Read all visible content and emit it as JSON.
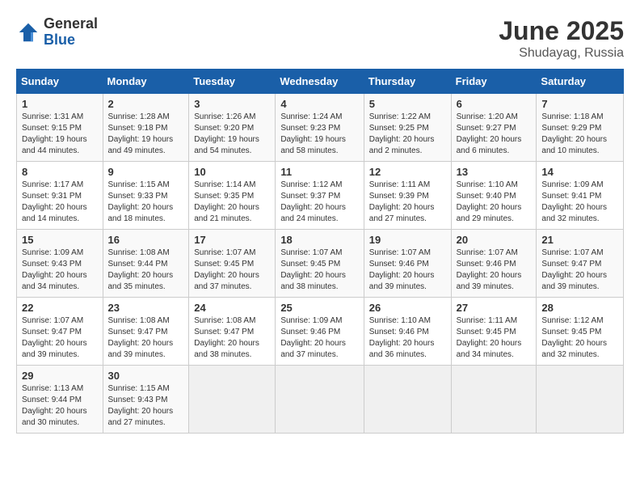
{
  "header": {
    "logo_general": "General",
    "logo_blue": "Blue",
    "month": "June 2025",
    "location": "Shudayag, Russia"
  },
  "days_of_week": [
    "Sunday",
    "Monday",
    "Tuesday",
    "Wednesday",
    "Thursday",
    "Friday",
    "Saturday"
  ],
  "weeks": [
    [
      {
        "day": "1",
        "info": "Sunrise: 1:31 AM\nSunset: 9:15 PM\nDaylight: 19 hours\nand 44 minutes."
      },
      {
        "day": "2",
        "info": "Sunrise: 1:28 AM\nSunset: 9:18 PM\nDaylight: 19 hours\nand 49 minutes."
      },
      {
        "day": "3",
        "info": "Sunrise: 1:26 AM\nSunset: 9:20 PM\nDaylight: 19 hours\nand 54 minutes."
      },
      {
        "day": "4",
        "info": "Sunrise: 1:24 AM\nSunset: 9:23 PM\nDaylight: 19 hours\nand 58 minutes."
      },
      {
        "day": "5",
        "info": "Sunrise: 1:22 AM\nSunset: 9:25 PM\nDaylight: 20 hours\nand 2 minutes."
      },
      {
        "day": "6",
        "info": "Sunrise: 1:20 AM\nSunset: 9:27 PM\nDaylight: 20 hours\nand 6 minutes."
      },
      {
        "day": "7",
        "info": "Sunrise: 1:18 AM\nSunset: 9:29 PM\nDaylight: 20 hours\nand 10 minutes."
      }
    ],
    [
      {
        "day": "8",
        "info": "Sunrise: 1:17 AM\nSunset: 9:31 PM\nDaylight: 20 hours\nand 14 minutes."
      },
      {
        "day": "9",
        "info": "Sunrise: 1:15 AM\nSunset: 9:33 PM\nDaylight: 20 hours\nand 18 minutes."
      },
      {
        "day": "10",
        "info": "Sunrise: 1:14 AM\nSunset: 9:35 PM\nDaylight: 20 hours\nand 21 minutes."
      },
      {
        "day": "11",
        "info": "Sunrise: 1:12 AM\nSunset: 9:37 PM\nDaylight: 20 hours\nand 24 minutes."
      },
      {
        "day": "12",
        "info": "Sunrise: 1:11 AM\nSunset: 9:39 PM\nDaylight: 20 hours\nand 27 minutes."
      },
      {
        "day": "13",
        "info": "Sunrise: 1:10 AM\nSunset: 9:40 PM\nDaylight: 20 hours\nand 29 minutes."
      },
      {
        "day": "14",
        "info": "Sunrise: 1:09 AM\nSunset: 9:41 PM\nDaylight: 20 hours\nand 32 minutes."
      }
    ],
    [
      {
        "day": "15",
        "info": "Sunrise: 1:09 AM\nSunset: 9:43 PM\nDaylight: 20 hours\nand 34 minutes."
      },
      {
        "day": "16",
        "info": "Sunrise: 1:08 AM\nSunset: 9:44 PM\nDaylight: 20 hours\nand 35 minutes."
      },
      {
        "day": "17",
        "info": "Sunrise: 1:07 AM\nSunset: 9:45 PM\nDaylight: 20 hours\nand 37 minutes."
      },
      {
        "day": "18",
        "info": "Sunrise: 1:07 AM\nSunset: 9:45 PM\nDaylight: 20 hours\nand 38 minutes."
      },
      {
        "day": "19",
        "info": "Sunrise: 1:07 AM\nSunset: 9:46 PM\nDaylight: 20 hours\nand 39 minutes."
      },
      {
        "day": "20",
        "info": "Sunrise: 1:07 AM\nSunset: 9:46 PM\nDaylight: 20 hours\nand 39 minutes."
      },
      {
        "day": "21",
        "info": "Sunrise: 1:07 AM\nSunset: 9:47 PM\nDaylight: 20 hours\nand 39 minutes."
      }
    ],
    [
      {
        "day": "22",
        "info": "Sunrise: 1:07 AM\nSunset: 9:47 PM\nDaylight: 20 hours\nand 39 minutes."
      },
      {
        "day": "23",
        "info": "Sunrise: 1:08 AM\nSunset: 9:47 PM\nDaylight: 20 hours\nand 39 minutes."
      },
      {
        "day": "24",
        "info": "Sunrise: 1:08 AM\nSunset: 9:47 PM\nDaylight: 20 hours\nand 38 minutes."
      },
      {
        "day": "25",
        "info": "Sunrise: 1:09 AM\nSunset: 9:46 PM\nDaylight: 20 hours\nand 37 minutes."
      },
      {
        "day": "26",
        "info": "Sunrise: 1:10 AM\nSunset: 9:46 PM\nDaylight: 20 hours\nand 36 minutes."
      },
      {
        "day": "27",
        "info": "Sunrise: 1:11 AM\nSunset: 9:45 PM\nDaylight: 20 hours\nand 34 minutes."
      },
      {
        "day": "28",
        "info": "Sunrise: 1:12 AM\nSunset: 9:45 PM\nDaylight: 20 hours\nand 32 minutes."
      }
    ],
    [
      {
        "day": "29",
        "info": "Sunrise: 1:13 AM\nSunset: 9:44 PM\nDaylight: 20 hours\nand 30 minutes."
      },
      {
        "day": "30",
        "info": "Sunrise: 1:15 AM\nSunset: 9:43 PM\nDaylight: 20 hours\nand 27 minutes."
      },
      {
        "day": "",
        "info": ""
      },
      {
        "day": "",
        "info": ""
      },
      {
        "day": "",
        "info": ""
      },
      {
        "day": "",
        "info": ""
      },
      {
        "day": "",
        "info": ""
      }
    ]
  ]
}
